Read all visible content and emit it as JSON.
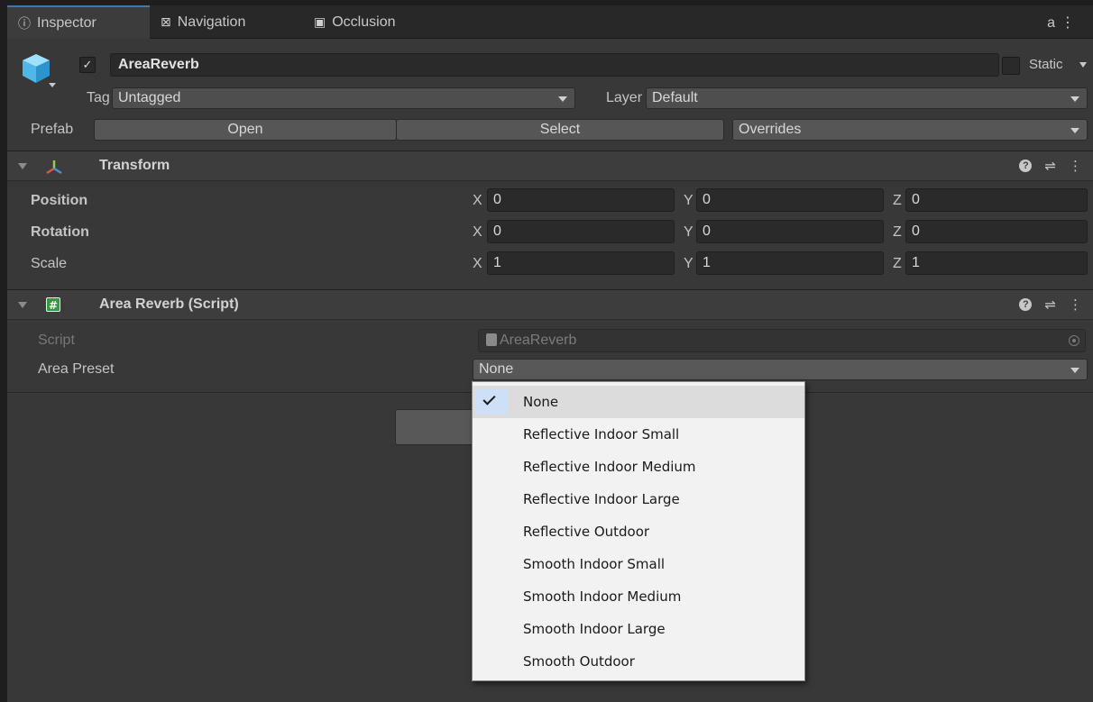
{
  "tabs": [
    {
      "label": "Inspector",
      "icon": "info-icon"
    },
    {
      "label": "Navigation",
      "icon": "navigation-icon"
    },
    {
      "label": "Occlusion",
      "icon": "occlusion-icon"
    }
  ],
  "tab_tools": {
    "lock_icon": "lock-icon",
    "menu_icon": "kebab-menu-icon"
  },
  "gameobject": {
    "icon": "cube-icon",
    "active_check": "✓",
    "name": "AreaReverb",
    "static_label": "Static",
    "tag_label": "Tag",
    "tag_value": "Untagged",
    "layer_label": "Layer",
    "layer_value": "Default",
    "prefab_label": "Prefab",
    "open_label": "Open",
    "select_label": "Select",
    "overrides_label": "Overrides"
  },
  "transform": {
    "title": "Transform",
    "icon": "transform-icon",
    "rows": [
      {
        "label": "Position",
        "x": "0",
        "y": "0",
        "z": "0"
      },
      {
        "label": "Rotation",
        "x": "0",
        "y": "0",
        "z": "0"
      },
      {
        "label": "Scale",
        "x": "1",
        "y": "1",
        "z": "1"
      }
    ],
    "axis_labels": {
      "x": "X",
      "y": "Y",
      "z": "Z"
    }
  },
  "script_component": {
    "title": "Area Reverb (Script)",
    "icon": "csharp-script-icon",
    "script_label": "Script",
    "script_value": "AreaReverb",
    "preset_label": "Area Preset",
    "preset_value": "None"
  },
  "component_tools": {
    "help": "?",
    "settings_icon": "sliders-icon",
    "menu_icon": "kebab-menu-icon"
  },
  "preset_menu": {
    "selected_index": 0,
    "items": [
      "None",
      "Reflective Indoor Small",
      "Reflective Indoor Medium",
      "Reflective Indoor Large",
      "Reflective Outdoor",
      "Smooth Indoor Small",
      "Smooth Indoor Medium",
      "Smooth Indoor Large",
      "Smooth Outdoor"
    ]
  },
  "colors": {
    "panel_bg": "#383838",
    "header_bg": "#3d3d3d",
    "field_bg": "#2a2a2a",
    "tab_accent": "#3a79bb",
    "menu_bg": "#f2f2f2",
    "menu_check_bg": "#cde0f5"
  }
}
